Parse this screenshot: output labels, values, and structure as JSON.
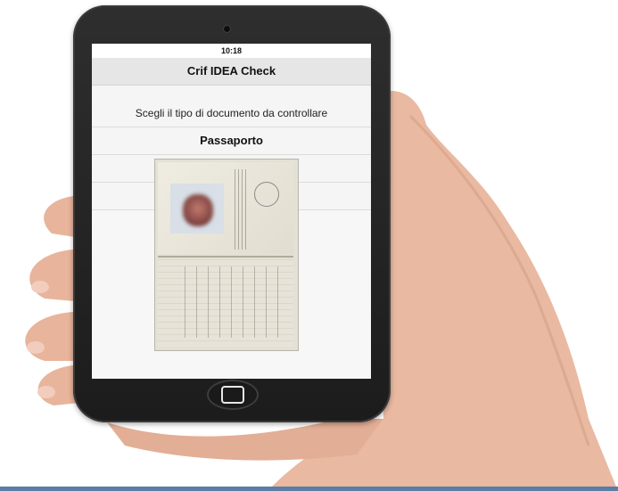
{
  "status_bar": {
    "time": "10:18"
  },
  "nav": {
    "title": "Crif IDEA Check"
  },
  "content": {
    "subtitle": "Scegli il tipo di documento da controllare",
    "options": [
      {
        "label": "Passaporto"
      }
    ]
  },
  "icons": {
    "home_button": "home-button-icon",
    "camera": "camera-icon"
  },
  "colors": {
    "nav_background": "#e6e6e6",
    "tablet_body": "#1c1c1c",
    "screen_background": "#f7f7f7"
  }
}
